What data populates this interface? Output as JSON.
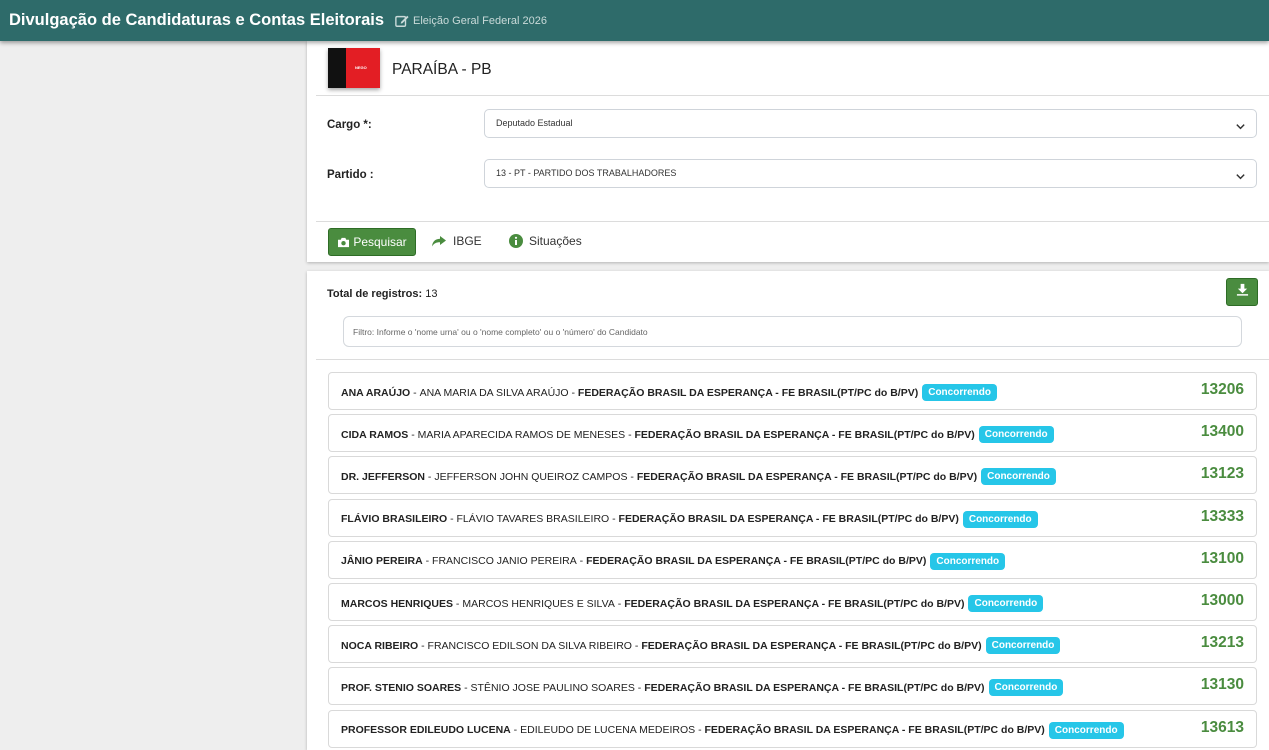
{
  "header": {
    "app_title": "Divulgação de Candidaturas e Contas Eleitorais",
    "election": "Eleição Geral Federal 2026"
  },
  "state": {
    "name": "PARAÍBA - PB",
    "flag_text": "NEGO"
  },
  "filters": {
    "cargo_label": "Cargo *:",
    "cargo_value": "Deputado Estadual",
    "partido_label": "Partido :",
    "partido_value": "13 - PT - PARTIDO DOS TRABALHADORES"
  },
  "actions": {
    "pesquisar": "Pesquisar",
    "ibge": "IBGE",
    "situacoes": "Situações"
  },
  "results": {
    "total_label": "Total de registros:",
    "total_value": "13",
    "filter_placeholder": "Filtro: Informe o 'nome urna' ou o 'nome completo' ou o 'número' do Candidato",
    "candidates": [
      {
        "urna": "ANA ARAÚJO",
        "nome": "ANA MARIA DA SILVA ARAÚJO",
        "partido": "FEDERAÇÃO BRASIL DA ESPERANÇA - FE BRASIL(PT/PC do B/PV)",
        "situacao": "Concorrendo",
        "numero": "13206"
      },
      {
        "urna": "CIDA RAMOS",
        "nome": "MARIA APARECIDA RAMOS DE MENESES",
        "partido": "FEDERAÇÃO BRASIL DA ESPERANÇA - FE BRASIL(PT/PC do B/PV)",
        "situacao": "Concorrendo",
        "numero": "13400"
      },
      {
        "urna": "DR. JEFFERSON",
        "nome": "JEFFERSON JOHN QUEIROZ CAMPOS",
        "partido": "FEDERAÇÃO BRASIL DA ESPERANÇA - FE BRASIL(PT/PC do B/PV)",
        "situacao": "Concorrendo",
        "numero": "13123"
      },
      {
        "urna": "FLÁVIO BRASILEIRO",
        "nome": "FLÁVIO TAVARES BRASILEIRO",
        "partido": "FEDERAÇÃO BRASIL DA ESPERANÇA - FE BRASIL(PT/PC do B/PV)",
        "situacao": "Concorrendo",
        "numero": "13333"
      },
      {
        "urna": "JÂNIO PEREIRA",
        "nome": "FRANCISCO JANIO PEREIRA",
        "partido": "FEDERAÇÃO BRASIL DA ESPERANÇA - FE BRASIL(PT/PC do B/PV)",
        "situacao": "Concorrendo",
        "numero": "13100"
      },
      {
        "urna": "MARCOS HENRIQUES",
        "nome": "MARCOS HENRIQUES E SILVA",
        "partido": "FEDERAÇÃO BRASIL DA ESPERANÇA - FE BRASIL(PT/PC do B/PV)",
        "situacao": "Concorrendo",
        "numero": "13000"
      },
      {
        "urna": "NOCA RIBEIRO",
        "nome": "FRANCISCO EDILSON DA SILVA RIBEIRO",
        "partido": "FEDERAÇÃO BRASIL DA ESPERANÇA - FE BRASIL(PT/PC do B/PV)",
        "situacao": "Concorrendo",
        "numero": "13213"
      },
      {
        "urna": "PROF. STENIO SOARES",
        "nome": "STÊNIO JOSE PAULINO SOARES",
        "partido": "FEDERAÇÃO BRASIL DA ESPERANÇA - FE BRASIL(PT/PC do B/PV)",
        "situacao": "Concorrendo",
        "numero": "13130"
      },
      {
        "urna": "PROFESSOR EDILEUDO LUCENA",
        "nome": "EDILEUDO DE LUCENA MEDEIROS",
        "partido": "FEDERAÇÃO BRASIL DA ESPERANÇA - FE BRASIL(PT/PC do B/PV)",
        "situacao": "Concorrendo",
        "numero": "13613"
      }
    ]
  },
  "colors": {
    "header_bg": "#2e6b6a",
    "primary_green": "#4a8c3f",
    "badge_cyan": "#26c6e8"
  },
  "icons": {
    "edit": "edit-icon",
    "camera": "camera-icon",
    "share": "share-icon",
    "info": "info-icon",
    "download": "download-icon",
    "chevron": "chevron-down-icon"
  }
}
